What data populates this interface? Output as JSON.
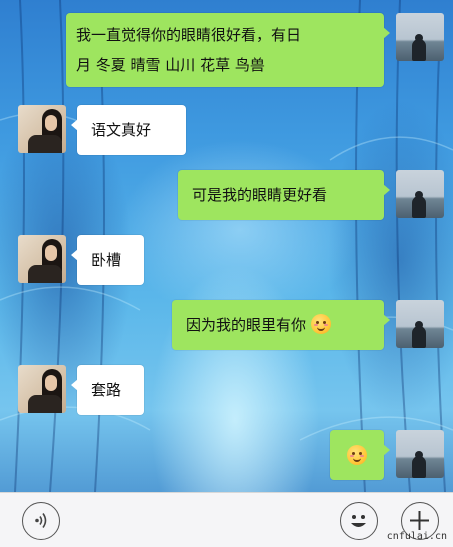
{
  "messages": [
    {
      "sender": "me",
      "text_line1": "我一直觉得你的眼睛很好看，有日",
      "text_line2": "月 冬夏 晴雪 山川 花草 鸟兽"
    },
    {
      "sender": "them",
      "text": "语文真好"
    },
    {
      "sender": "me",
      "text": "可是我的眼睛更好看"
    },
    {
      "sender": "them",
      "text": "卧槽"
    },
    {
      "sender": "me",
      "text": "因为我的眼里有你",
      "emoji": "smile-blush-emoji"
    },
    {
      "sender": "them",
      "text": "套路"
    },
    {
      "sender": "me",
      "text": "",
      "emoji": "smile-blush-emoji"
    }
  ],
  "input_bar": {
    "voice_icon": "voice-wave-icon",
    "emoji_icon": "smiley-icon",
    "plus_icon": "plus-icon",
    "input_value": ""
  },
  "watermark": "cnfulai.cn",
  "colors": {
    "sent_bubble": "#9ee55f",
    "received_bubble": "#ffffff",
    "input_bar_bg": "#f5f5f7"
  }
}
